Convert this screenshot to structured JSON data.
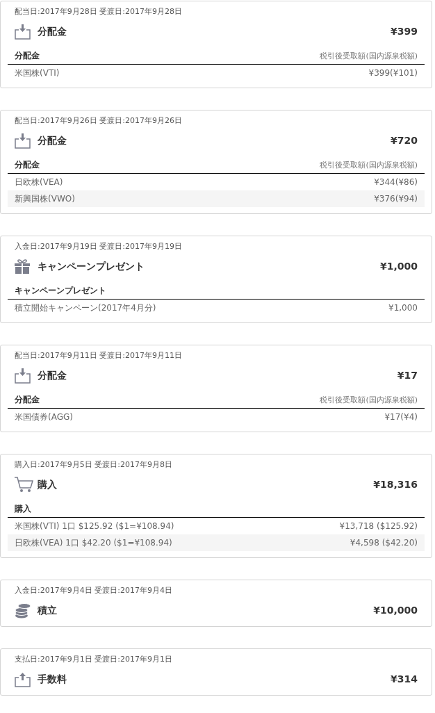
{
  "entries": [
    {
      "dates": "配当日:2017年9月28日 受渡日:2017年9月28日",
      "kind": "download",
      "title": "分配金",
      "amount": "¥399",
      "detail": {
        "label": "分配金",
        "note": "税引後受取額(国内源泉税額)",
        "rows": [
          {
            "name": "米国株(VTI)",
            "value": "¥399(¥101)"
          }
        ]
      }
    },
    {
      "dates": "配当日:2017年9月26日 受渡日:2017年9月26日",
      "kind": "download",
      "title": "分配金",
      "amount": "¥720",
      "detail": {
        "label": "分配金",
        "note": "税引後受取額(国内源泉税額)",
        "rows": [
          {
            "name": "日欧株(VEA)",
            "value": "¥344(¥86)"
          },
          {
            "name": "新興国株(VWO)",
            "value": "¥376(¥94)"
          }
        ]
      }
    },
    {
      "dates": "入金日:2017年9月19日 受渡日:2017年9月19日",
      "kind": "gift",
      "title": "キャンペーンプレゼント",
      "amount": "¥1,000",
      "detail": {
        "label": "キャンペーンプレゼント",
        "rows": [
          {
            "name": "積立開始キャンペーン(2017年4月分)",
            "value": "¥1,000"
          }
        ]
      }
    },
    {
      "dates": "配当日:2017年9月11日 受渡日:2017年9月11日",
      "kind": "download",
      "title": "分配金",
      "amount": "¥17",
      "detail": {
        "label": "分配金",
        "note": "税引後受取額(国内源泉税額)",
        "rows": [
          {
            "name": "米国債券(AGG)",
            "value": "¥17(¥4)"
          }
        ]
      }
    },
    {
      "dates": "購入日:2017年9月5日 受渡日:2017年9月8日",
      "kind": "cart",
      "title": "購入",
      "amount": "¥18,316",
      "detail": {
        "label": "購入",
        "rows": [
          {
            "name": "米国株(VTI) 1口 $125.92 ($1=¥108.94)",
            "value": "¥13,718 ($125.92)"
          },
          {
            "name": "日欧株(VEA) 1口 $42.20 ($1=¥108.94)",
            "value": "¥4,598 ($42.20)"
          }
        ]
      }
    },
    {
      "dates": "入金日:2017年9月4日 受渡日:2017年9月4日",
      "kind": "coins",
      "title": "積立",
      "amount": "¥10,000"
    },
    {
      "dates": "支払日:2017年9月1日 受渡日:2017年9月1日",
      "kind": "upload",
      "title": "手数料",
      "amount": "¥314"
    }
  ]
}
